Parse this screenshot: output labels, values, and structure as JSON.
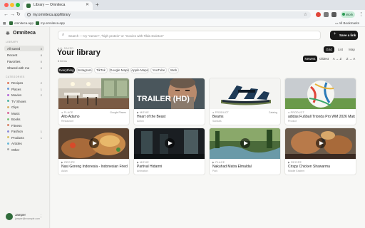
{
  "browser": {
    "tab_title": "Library — Omniteca",
    "url": "my.omniteca.app/library",
    "profile_label": "Work",
    "bookmarks": [
      "omniteca.app",
      "my.omniteca.app"
    ],
    "all_bookmarks": "All Bookmarks"
  },
  "sidebar": {
    "brand": "Omniteca",
    "library_label": "LIBRARY",
    "items": [
      {
        "label": "All saved",
        "count": "8"
      },
      {
        "label": "Recent",
        "count": "8"
      },
      {
        "label": "Favorites",
        "count": "0"
      },
      {
        "label": "Shared with me",
        "count": "0"
      }
    ],
    "categories_label": "CATEGORIES",
    "categories": [
      {
        "label": "Recipes",
        "count": "2",
        "color": "#e07a5f"
      },
      {
        "label": "Places",
        "count": "1",
        "color": "#6a9bd8"
      },
      {
        "label": "Movies",
        "count": "2",
        "color": "#b56ad8"
      },
      {
        "label": "TV Shows",
        "count": "",
        "color": "#4fb3a3"
      },
      {
        "label": "Clips",
        "count": "",
        "color": "#d8b26a"
      },
      {
        "label": "Music",
        "count": "",
        "color": "#d86a9b"
      },
      {
        "label": "Books",
        "count": "",
        "color": "#7ac47a"
      },
      {
        "label": "Fitness",
        "count": "",
        "color": "#d8856a"
      },
      {
        "label": "Fashion",
        "count": "1",
        "color": "#8c8cd8"
      },
      {
        "label": "Products",
        "count": "1",
        "color": "#d8c36a"
      },
      {
        "label": "Articles",
        "count": "",
        "color": "#6ab8d8"
      },
      {
        "label": "Other",
        "count": "",
        "color": "#aaaaaa"
      }
    ],
    "user": {
      "name": "Jamper",
      "email": "jamper@example.com"
    }
  },
  "main": {
    "search_placeholder": "Search — try \"ramen\", \"high protein\" or \"movies with Tilda Swinton\"",
    "save_button": "Save a link",
    "kicker": "ALL SAVED",
    "title": "Your library",
    "count": "8 items",
    "view_options": [
      "Grid",
      "List",
      "Map"
    ],
    "sort_options": [
      "Newest",
      "Oldest",
      "A → Z",
      "Z → A"
    ],
    "filters": [
      "Everything",
      "Instagram",
      "TikTok",
      "Google Maps",
      "Apple Maps",
      "YouTube",
      "Web"
    ]
  },
  "cards": [
    {
      "source": "● PLACE",
      "category": "Google Places",
      "title": "Alto Adamo",
      "subtitle": "Restaurant",
      "video": false
    },
    {
      "source": "▶ MOVIE",
      "category": "",
      "title": "Heart of the Beast",
      "subtitle": "Action",
      "video": false
    },
    {
      "source": "● PRODUCT",
      "category": "Catalog",
      "title": "Beams",
      "subtitle": "Sandals",
      "video": false
    },
    {
      "source": "● PRODUCT",
      "category": "",
      "title": "adidas Fußball Trionda Pro WM 2026 Matchball",
      "subtitle": "Product",
      "video": false
    },
    {
      "source": "▶ RECIPE",
      "category": "",
      "title": "Nasi Goreng Indonesia - Indonesian Fried Rice",
      "subtitle": "Asian",
      "video": true
    },
    {
      "source": "▶ MOVIE",
      "category": "",
      "title": "Partival Hidamri",
      "subtitle": "Animation",
      "video": true
    },
    {
      "source": "▶ PLACE",
      "category": "",
      "title": "Nakuhad Matra Elmaldal",
      "subtitle": "Park",
      "video": true
    },
    {
      "source": "▶ RECIPE",
      "category": "",
      "title": "Crispy Chicken Shawarma",
      "subtitle": "Middle Eastern",
      "video": true
    }
  ],
  "thumb_overlay_text": "TRAILER (HD)",
  "colors": {
    "accent": "#181818",
    "brand": "#2f6b3a",
    "work_pill": "#c9ecd8"
  }
}
